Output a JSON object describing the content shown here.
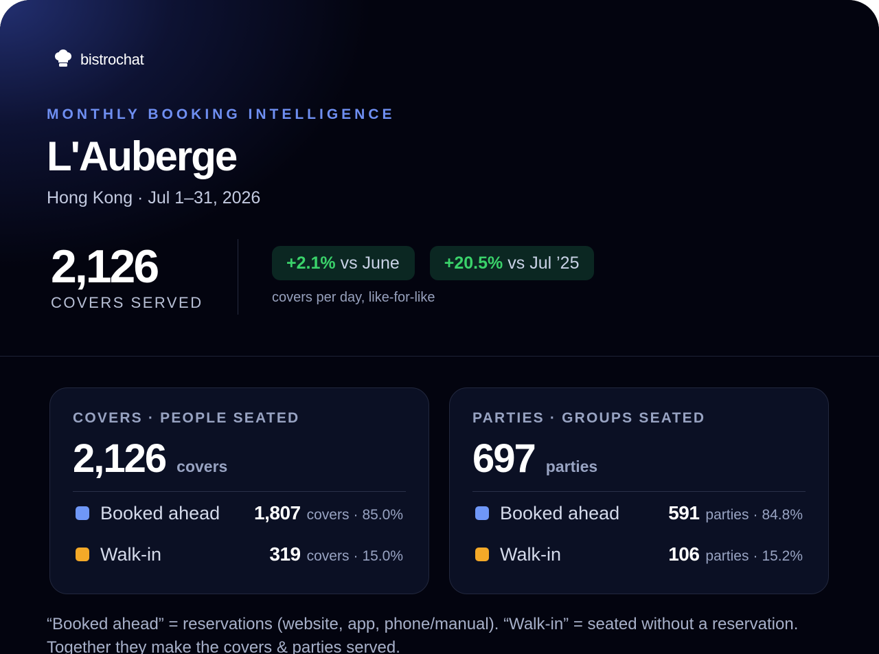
{
  "brand": {
    "name": "bistrochat",
    "logo_icon": "chef-hat-icon"
  },
  "header": {
    "eyebrow": "MONTHLY BOOKING INTELLIGENCE",
    "venue": "L'Auberge",
    "subtitle": "Hong Kong · Jul 1–31, 2026"
  },
  "summary": {
    "total_value": "2,126",
    "total_label": "COVERS SERVED",
    "chips": [
      {
        "delta": "+2.1%",
        "label": "vs June"
      },
      {
        "delta": "+20.5%",
        "label": "vs Jul ’25"
      }
    ],
    "chips_note": "covers per day, like-for-like"
  },
  "cards": [
    {
      "title": "COVERS · PEOPLE SEATED",
      "value": "2,126",
      "unit": "covers",
      "rows": [
        {
          "label": "Booked ahead",
          "value": "1,807",
          "unit": "covers",
          "percent": "85.0%",
          "color": "#6f97f7"
        },
        {
          "label": "Walk-in",
          "value": "319",
          "unit": "covers",
          "percent": "15.0%",
          "color": "#f4a928"
        }
      ]
    },
    {
      "title": "PARTIES · GROUPS SEATED",
      "value": "697",
      "unit": "parties",
      "rows": [
        {
          "label": "Booked ahead",
          "value": "591",
          "unit": "parties",
          "percent": "84.8%",
          "color": "#6f97f7"
        },
        {
          "label": "Walk-in",
          "value": "106",
          "unit": "parties",
          "percent": "15.2%",
          "color": "#f4a928"
        }
      ]
    }
  ],
  "footnote": "“Booked ahead” = reservations (website, app, phone/manual). “Walk-in” = seated without a reservation. Together they make the covers & parties served.",
  "colors": {
    "accent": "#6f8ff2",
    "positive": "#3ad26a",
    "booked_ahead": "#6f97f7",
    "walk_in": "#f4a928"
  },
  "dot_separator": "·"
}
